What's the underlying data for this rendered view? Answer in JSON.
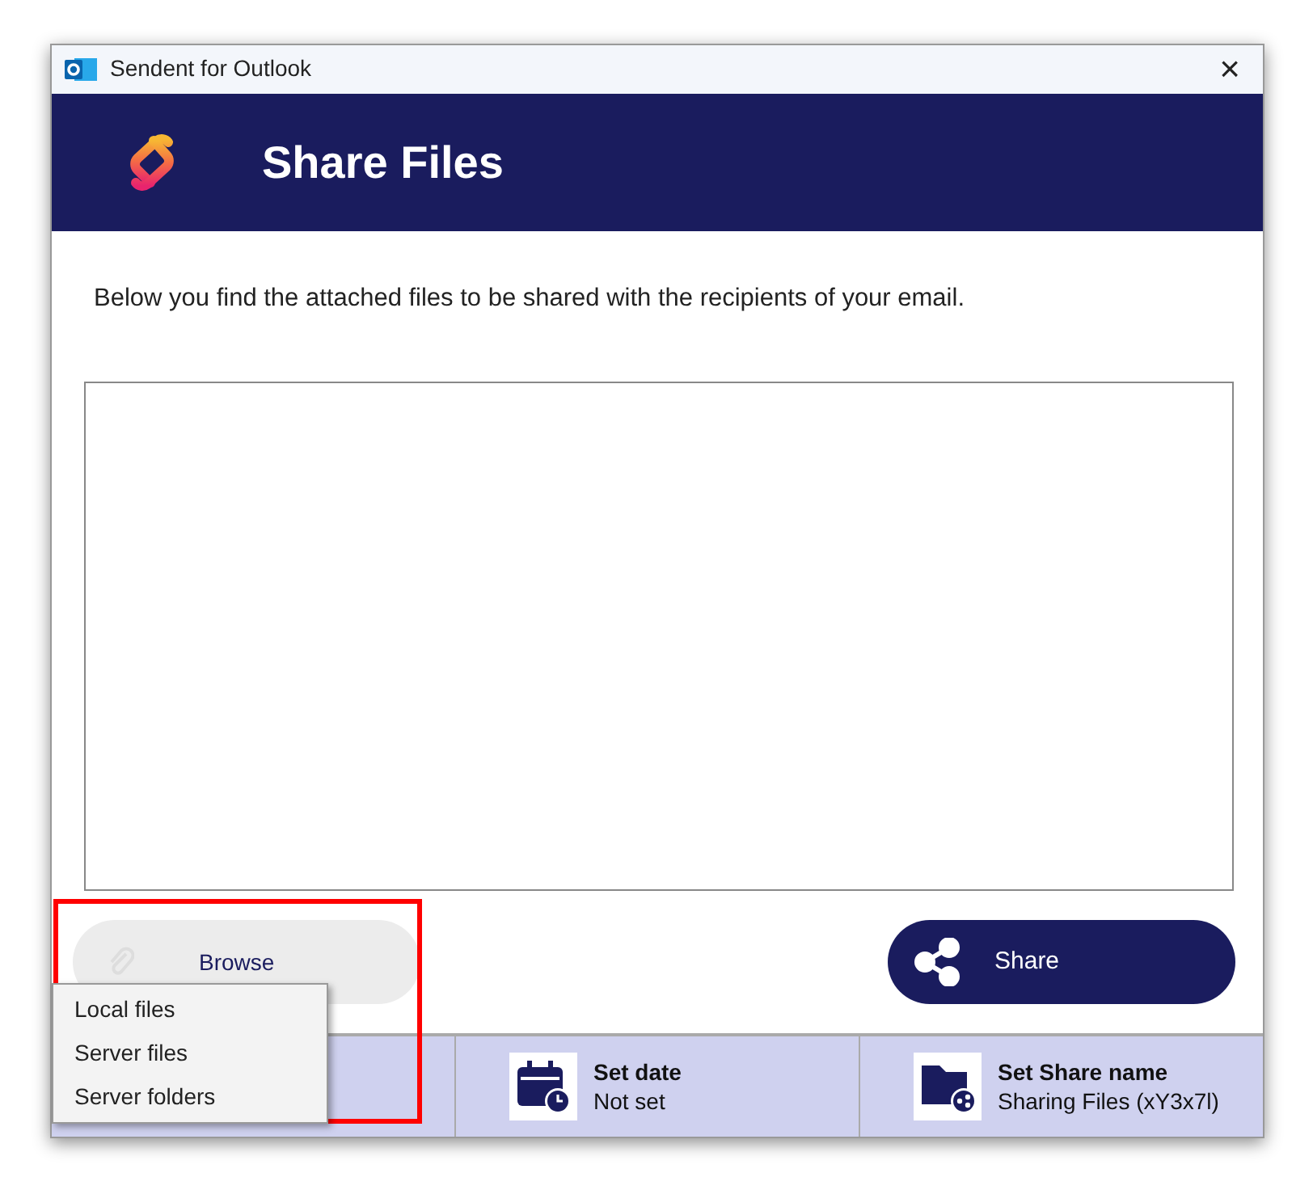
{
  "window": {
    "title": "Sendent for Outlook",
    "close": "×"
  },
  "header": {
    "title": "Share Files"
  },
  "description": "Below you find the attached files to be shared with the recipients of your email.",
  "browse_button": {
    "label": "Browse",
    "disabled": true
  },
  "share_button": {
    "label": "Share"
  },
  "browse_menu": {
    "items": [
      {
        "label": "Local files"
      },
      {
        "label": "Server files"
      },
      {
        "label": "Server folders"
      }
    ]
  },
  "footer": [
    {
      "kind": "hidden"
    },
    {
      "kind": "date",
      "title": "Set date",
      "value": "Not set"
    },
    {
      "kind": "share-name",
      "title": "Set Share name",
      "value": "Sharing Files (xY3x7l)"
    }
  ]
}
